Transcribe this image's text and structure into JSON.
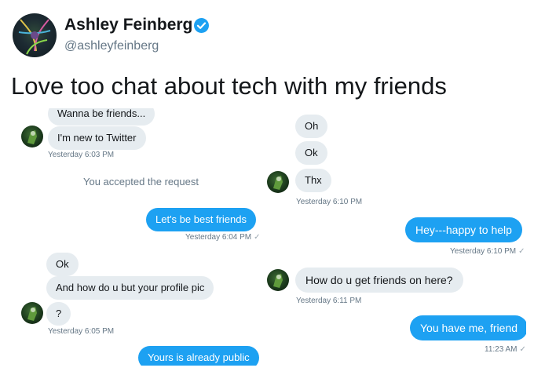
{
  "tweet": {
    "author_name": "Ashley Feinberg",
    "handle": "@ashleyfeinberg",
    "text": "Love too chat about tech with my friends",
    "verified": true
  },
  "left_thread": {
    "messages": [
      {
        "dir": "in",
        "text": "Wanna be friends..."
      },
      {
        "dir": "in",
        "text": "I'm new to Twitter"
      },
      {
        "dir": "time",
        "text": "Yesterday 6:03 PM"
      },
      {
        "dir": "system",
        "text": "You accepted the request"
      },
      {
        "dir": "out",
        "text": "Let's be best friends"
      },
      {
        "dir": "time",
        "text": "Yesterday 6:04 PM"
      },
      {
        "dir": "in",
        "text": "Ok"
      },
      {
        "dir": "in",
        "text": "And how do u but your profile pic"
      },
      {
        "dir": "in",
        "text": "?"
      },
      {
        "dir": "time",
        "text": "Yesterday 6:05 PM"
      },
      {
        "dir": "out",
        "text": "Yours is already public"
      }
    ]
  },
  "right_thread": {
    "messages": [
      {
        "dir": "in",
        "text": "Oh"
      },
      {
        "dir": "in",
        "text": "Ok"
      },
      {
        "dir": "in",
        "text": "Thx"
      },
      {
        "dir": "time",
        "text": "Yesterday 6:10 PM"
      },
      {
        "dir": "out",
        "text": "Hey---happy to help"
      },
      {
        "dir": "time",
        "text": "Yesterday 6:10 PM"
      },
      {
        "dir": "in",
        "text": "How do u get friends on here?"
      },
      {
        "dir": "time",
        "text": "Yesterday 6:11 PM"
      },
      {
        "dir": "out",
        "text": "You have me, friend"
      },
      {
        "dir": "time",
        "text": "11:23 AM"
      }
    ]
  },
  "colors": {
    "outgoing_bubble": "#1da1f2",
    "incoming_bubble": "#e6ecf0",
    "timestamp": "#657786",
    "verified_badge": "#1da1f2"
  },
  "icons": {
    "verified": "verified-badge-icon",
    "read_receipt": "check-icon",
    "avatar": "user-avatar"
  }
}
